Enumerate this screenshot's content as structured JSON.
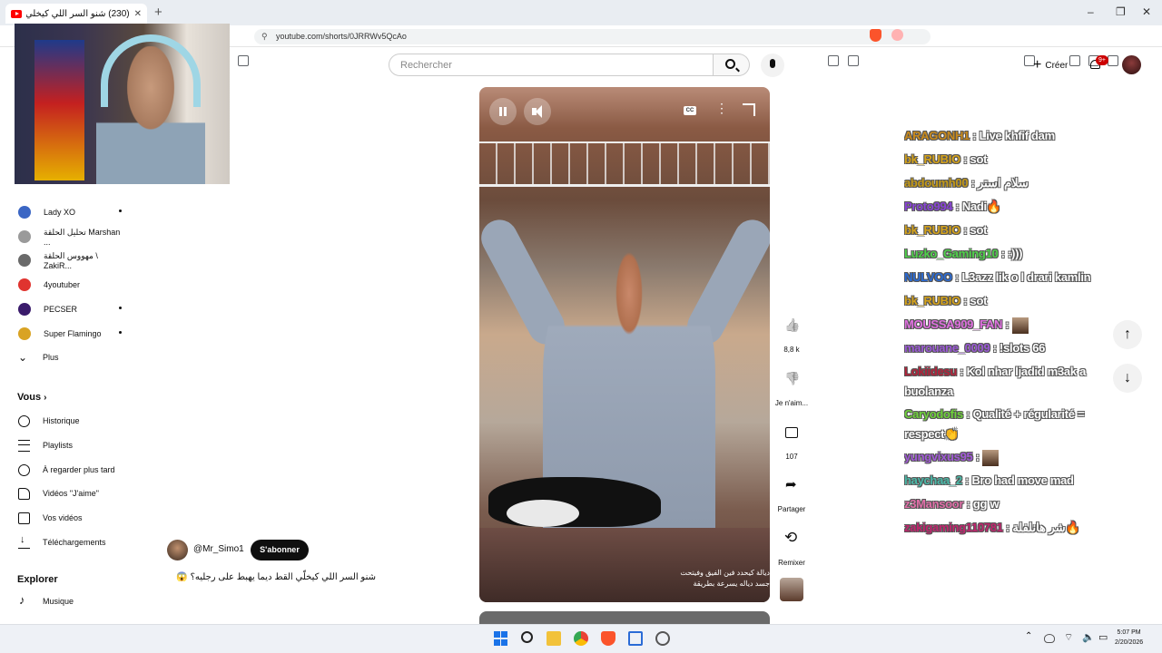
{
  "browser": {
    "tab_title": "(230) شنو السر اللي كيخلّي القط...",
    "tab_close": "✕",
    "new_tab": "+",
    "url": "youtube.com/shorts/0JRRWv5QcAo",
    "window_controls": [
      "–",
      "❐",
      "✕"
    ]
  },
  "header": {
    "search_placeholder": "Rechercher",
    "create_label": "Créer",
    "notif_badge": "9+"
  },
  "sidebar": {
    "subscriptions": [
      {
        "label": "Lady XO",
        "color": "#3b66c4"
      },
      {
        "label": "تحليل الحلقة Marshan ...",
        "color": "#9a9a9a"
      },
      {
        "label": "مهووس الحلقة \\ ZakiR...",
        "color": "#6a6a6a"
      },
      {
        "label": "4youtuber",
        "color": "#e0342f"
      },
      {
        "label": "PECSER",
        "color": "#3a1b6b"
      },
      {
        "label": "Super Flamingo",
        "color": "#d9a323"
      }
    ],
    "more_label": "Plus",
    "you_section": "Vous",
    "you_items": [
      {
        "label": "Historique",
        "icon": "history-icon"
      },
      {
        "label": "Playlists",
        "icon": "playlist-icon"
      },
      {
        "label": "À regarder plus tard",
        "icon": "clock-icon"
      },
      {
        "label": "Vidéos \"J'aime\"",
        "icon": "thumb-up-icon"
      },
      {
        "label": "Vos vidéos",
        "icon": "video-icon"
      },
      {
        "label": "Téléchargements",
        "icon": "download-icon"
      }
    ],
    "explore_section": "Explorer",
    "explore_items": [
      {
        "label": "Musique",
        "icon": "music-icon"
      }
    ]
  },
  "short": {
    "channel_handle": "@Mr_Simo1",
    "subscribe_label": "S'abonner",
    "title": "شنو السر اللي كيخلّي القط ديما يهبط على رجليه؟ 😱",
    "caption": "ديالة كيحدد فين الفيق وفيتحت جسد دياله يسرعة بطريقة",
    "cc_label": "CC"
  },
  "actions": {
    "like_count": "8,8 k",
    "dislike_label": "Je n'aim...",
    "comment_count": "107",
    "share_label": "Partager",
    "remix_label": "Remixer"
  },
  "chat": [
    {
      "user": "ARAGONH1",
      "color": "#c98a1c",
      "text": "Live khfif dam",
      "emoji": ""
    },
    {
      "user": "bk_RUBIO",
      "color": "#d6a31a",
      "text": "sot",
      "emoji": ""
    },
    {
      "user": "abdoumh00",
      "color": "#c49a18",
      "text": "سلام استر",
      "emoji": ""
    },
    {
      "user": "Proto994",
      "color": "#8a44d8",
      "text": "Nadi",
      "emoji": "🔥"
    },
    {
      "user": "bk_RUBIO",
      "color": "#d6a31a",
      "text": "sot",
      "emoji": ""
    },
    {
      "user": "Luzko_Gaming10",
      "color": "#4fd24a",
      "text": ":)))",
      "emoji": ""
    },
    {
      "user": "NULVOO",
      "color": "#2a6bd6",
      "text": "L3azz lik o l drari kamlin",
      "emoji": ""
    },
    {
      "user": "bk_RUBIO",
      "color": "#d6a31a",
      "text": "sot",
      "emoji": ""
    },
    {
      "user": "MOUSSA909_FAN",
      "color": "#e070e0",
      "text": "",
      "emoji": "avatar"
    },
    {
      "user": "marouane_0009",
      "color": "#9b59d6",
      "text": "!slots 66",
      "emoji": ""
    },
    {
      "user": "Lokiidesu",
      "color": "#b3223a",
      "text": "Kol nhar ljadid m3ak a buolanza",
      "emoji": ""
    },
    {
      "user": "Caryodofis",
      "color": "#6fd33a",
      "text": "Qualité + régularité = respect",
      "emoji": "👏"
    },
    {
      "user": "yungvixus95",
      "color": "#a25ad8",
      "text": "",
      "emoji": "avatar"
    },
    {
      "user": "haychaa_2",
      "color": "#49b9a8",
      "text": "Bro had move mad",
      "emoji": ""
    },
    {
      "user": "z3Mansoor",
      "color": "#e06fa8",
      "text": "gg w",
      "emoji": ""
    },
    {
      "user": "zakigaming110781",
      "color": "#c2246e",
      "text": "شر هانلفلة",
      "emoji": "🔥"
    }
  ],
  "taskbar": {
    "time": "5:07 PM",
    "date": "2/20/2026"
  },
  "colors": {
    "youtube_red": "#ff0000",
    "subscribe_bg": "#0f0f0f",
    "badge_red": "#cc0000"
  }
}
